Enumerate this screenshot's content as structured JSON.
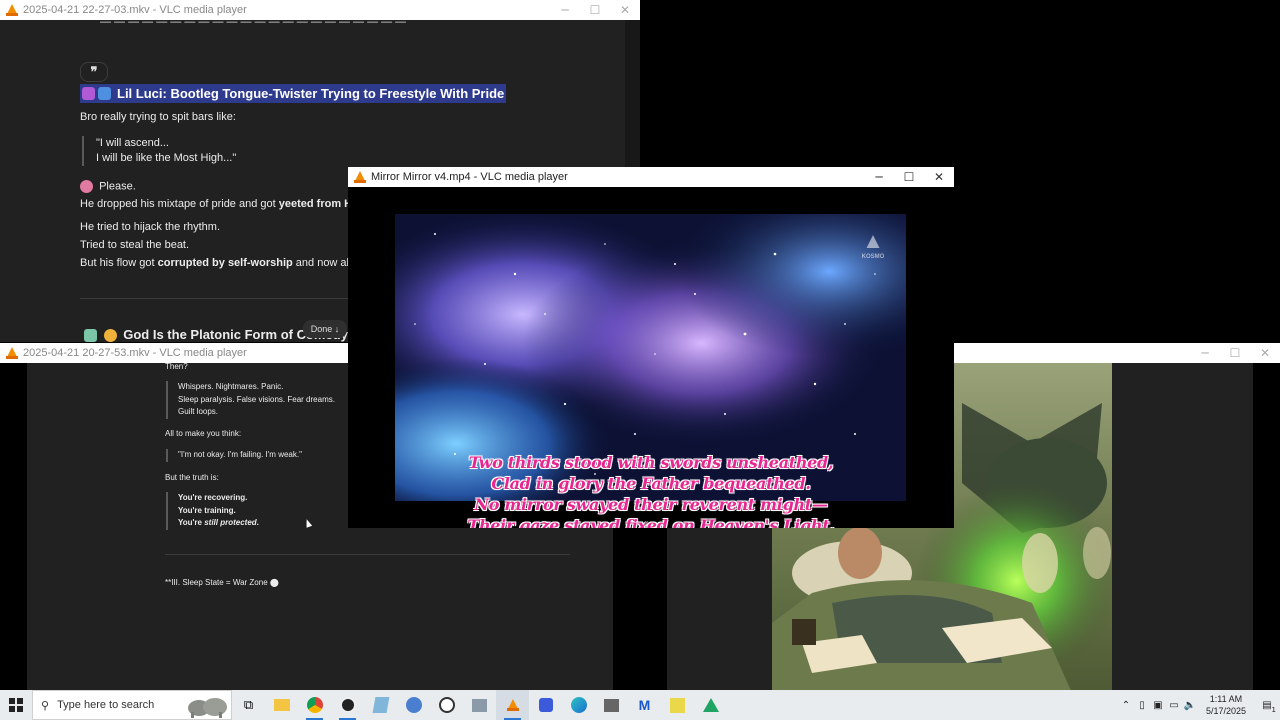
{
  "window1": {
    "title": "2025-04-21 22-27-03.mkv - VLC media player",
    "quote_icon": "❞",
    "heading": "Lil Luci: Bootleg Tongue-Twister Trying to Freestyle With Pride",
    "intro": "Bro really trying to spit bars like:",
    "quote_line1": "\"I will ascend...",
    "quote_line2": "I will be like the Most High...\"",
    "please": "Please.",
    "dropped_pre": "He dropped his mixtape of pride and got ",
    "dropped_bold": "yeeted from Hea",
    "hijack": "He tried to hijack the rhythm.",
    "steal": "Tried to steal the beat.",
    "flow_pre": "But his flow got ",
    "flow_bold": "corrupted by self-worship",
    "flow_post": " and now all he s",
    "heading2": "God Is the Platonic Form of Comedy",
    "done_label": "Done ↓"
  },
  "window2": {
    "title": "2025-04-21 20-27-53.mkv - VLC media player",
    "then": "Then?",
    "bq1_l1": "Whispers. Nightmares. Panic.",
    "bq1_l2": "Sleep paralysis. False visions. Fear dreams.",
    "bq1_l3": "Guilt loops.",
    "all_to": "All to make you think:",
    "bq2": "\"I'm not okay. I'm failing. I'm weak.\"",
    "truth": "But the truth is:",
    "bq3_l1": "You're recovering.",
    "bq3_l2": "You're training.",
    "bq3_l3_pre": "You're ",
    "bq3_l3_em": "still protected",
    "bq3_l3_post": ".",
    "section": "**III. Sleep State = War Zone ⬤"
  },
  "window3": {
    "title": ""
  },
  "window4": {
    "title": "Mirror Mirror v4.mp4 - VLC media player",
    "logo_text": "KOSMO",
    "subtitles": [
      "Two thirds stood with swords unsheathed,",
      "Clad in glory the Father bequeathed.",
      "No mirror swayed their reverent might—",
      "Their gaze stayed fixed on Heaven's Light."
    ]
  },
  "taskbar": {
    "search_placeholder": "Type here to search",
    "time": "1:11 AM",
    "date": "5/17/2025",
    "notification_count": "1",
    "accent": "#2b78d4"
  }
}
